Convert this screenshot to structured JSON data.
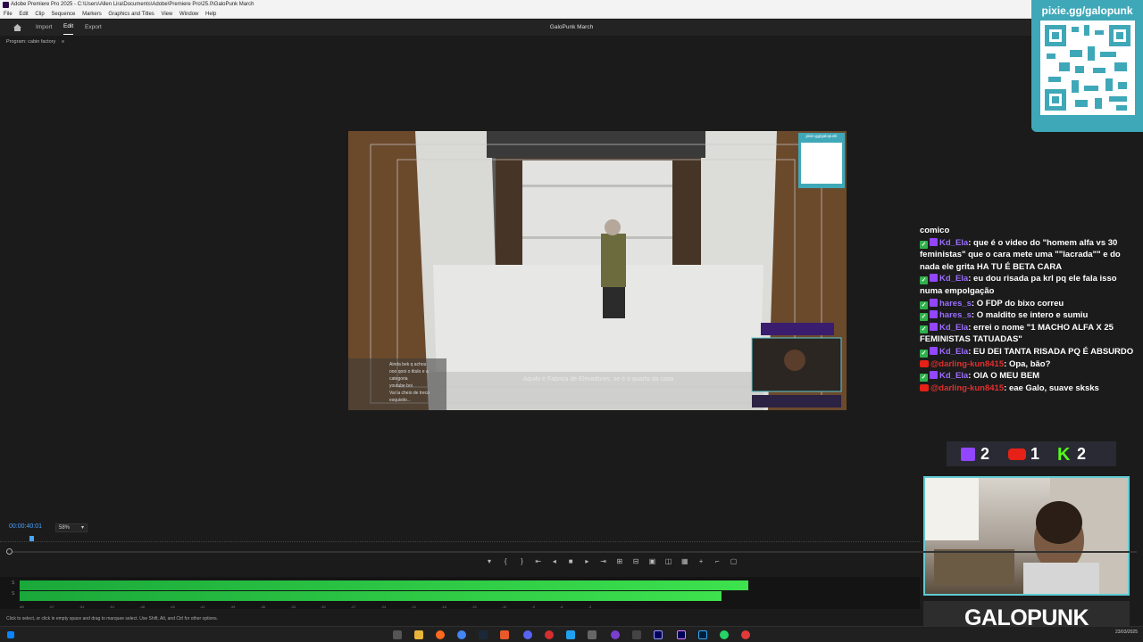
{
  "window": {
    "title": "Adobe Premiere Pro 2025 - C:\\Users\\Allen Lira\\Documents\\Adobe\\Premiere Pro\\25.0\\GaloPunk March"
  },
  "menu": [
    "File",
    "Edit",
    "Clip",
    "Sequence",
    "Markers",
    "Graphics and Titles",
    "View",
    "Window",
    "Help"
  ],
  "workspace": {
    "tabs": [
      "Import",
      "Edit",
      "Export"
    ],
    "active_tab": "Edit",
    "project_title": "GaloPunk March"
  },
  "program_monitor": {
    "panel_label": "Program: cabin factory",
    "timecode": "00:00:40:01",
    "zoom": "58%",
    "subtitle": "Aquilo é Fabrica de Elevadores, se é o quarto da casa",
    "overlay_chat": [
      "Ainda bek q achou",
      "ooo  qooi o titulo e a",
      "categoria",
      "youtube boi",
      "Vai la cheio de treco",
      "esquisito..."
    ],
    "overlay_qr_url": "pixie.gg/galopunk"
  },
  "stream_overlay": {
    "qr_url": "pixie.gg/galopunk",
    "chat_first": "comico",
    "chat": [
      {
        "platform": "twitch",
        "user": "Kd_Ela",
        "text": "que é o video do \"homem alfa vs 30 feministas\" que o cara mete uma \"\"lacrada\"\" e do nada ele grita HA TU É BETA CARA"
      },
      {
        "platform": "twitch",
        "user": "Kd_Ela",
        "text": "eu dou risada pa krl pq ele fala isso numa empolgação"
      },
      {
        "platform": "twitch",
        "user": "hares_s",
        "text": "O FDP do bixo correu"
      },
      {
        "platform": "twitch",
        "user": "hares_s",
        "text": "O maldito se intero e sumiu"
      },
      {
        "platform": "twitch",
        "user": "Kd_Ela",
        "text": "errei o nome \"1 MACHO ALFA X 25 FEMINISTAS TATUADAS\""
      },
      {
        "platform": "twitch",
        "user": "Kd_Ela",
        "text": "EU DEI TANTA RISADA PQ É ABSURDO"
      },
      {
        "platform": "youtube",
        "user": "@darling-kun8415",
        "text": "Opa, bão?"
      },
      {
        "platform": "twitch",
        "user": "Kd_Ela",
        "text": "OIA O MEU BEM"
      },
      {
        "platform": "youtube",
        "user": "@darling-kun8415",
        "text": "eae Galo, suave sksks"
      }
    ],
    "viewer_counts": {
      "twitch": "2",
      "youtube": "1",
      "kick": "2"
    },
    "streamer_name": "GALOPUNK"
  },
  "audio_meter": {
    "top_level": 0.81,
    "bottom_level": 0.78,
    "scale": [
      "dB",
      "-57",
      "-54",
      "-51",
      "-48",
      "-45",
      "-42",
      "-39",
      "-36",
      "-33",
      "-30",
      "-27",
      "-24",
      "-21",
      "-18",
      "-15",
      "-12",
      "-9",
      "-6",
      "-3"
    ]
  },
  "status_bar": "Click to select, or click in empty space and drag to marquee select. Use Shift, Alt, and Ctrl for other options.",
  "taskbar": {
    "clock": "23/03/2025"
  }
}
